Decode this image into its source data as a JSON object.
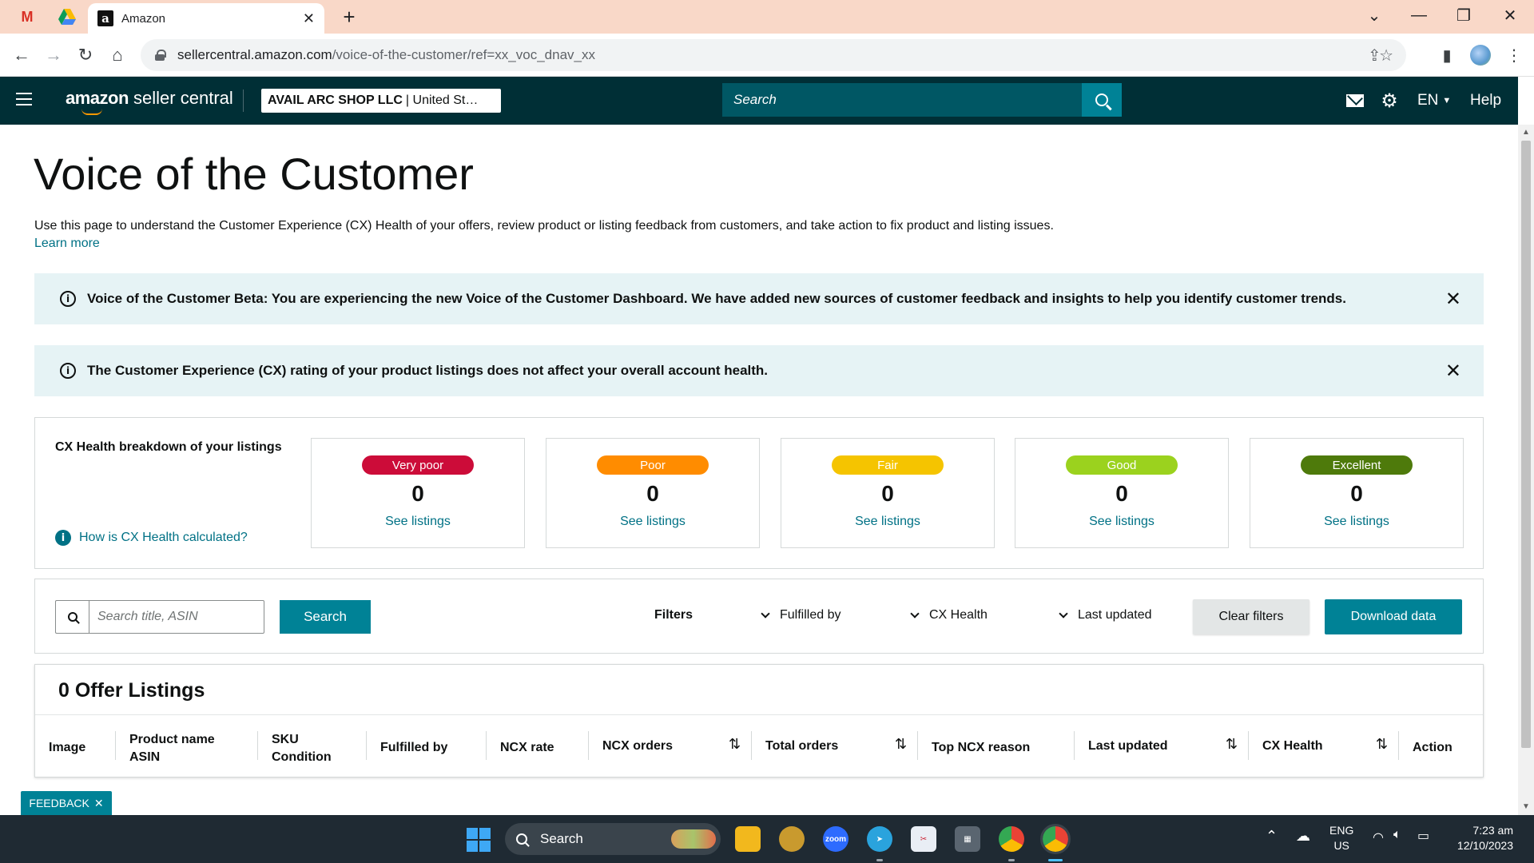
{
  "browser": {
    "active_tab_title": "Amazon",
    "url_host": "sellercentral.amazon.com",
    "url_path": "/voice-of-the-customer/ref=xx_voc_dnav_xx"
  },
  "header": {
    "logo_brand": "amazon",
    "logo_product": "seller central",
    "account_name": "AVAIL ARC SHOP LLC",
    "account_region": "| United St…",
    "search_placeholder": "Search",
    "language": "EN",
    "help": "Help"
  },
  "page": {
    "title": "Voice of the Customer",
    "description": "Use this page to understand the Customer Experience (CX) Health of your offers, review product or listing feedback from customers, and take action to fix product and listing issues.",
    "learn_more": "Learn more",
    "banners": [
      {
        "text": "Voice of the Customer Beta: You are experiencing the new Voice of the Customer Dashboard. We have added new sources of customer feedback and insights to help you identify customer trends."
      },
      {
        "text": "The Customer Experience (CX) rating of your product listings does not affect your overall account health."
      }
    ]
  },
  "cx_health": {
    "heading": "CX Health breakdown of your listings",
    "help_link": "How is CX Health calculated?",
    "cards": [
      {
        "label": "Very poor",
        "count": "0",
        "link": "See listings",
        "bg": "#cc0c39",
        "fg": "#ffffff"
      },
      {
        "label": "Poor",
        "count": "0",
        "link": "See listings",
        "bg": "#ff8c00",
        "fg": "#ffffff"
      },
      {
        "label": "Fair",
        "count": "0",
        "link": "See listings",
        "bg": "#f5c400",
        "fg": "#ffffff"
      },
      {
        "label": "Good",
        "count": "0",
        "link": "See listings",
        "bg": "#9bd21e",
        "fg": "#ffffff"
      },
      {
        "label": "Excellent",
        "count": "0",
        "link": "See listings",
        "bg": "#4e7a0b",
        "fg": "#ffffff"
      }
    ]
  },
  "filters": {
    "search_placeholder": "Search title, ASIN",
    "search_button": "Search",
    "label": "Filters",
    "fulfilled_by": "Fulfilled by",
    "cx_health": "CX Health",
    "last_updated": "Last updated",
    "clear": "Clear filters",
    "download": "Download data"
  },
  "table": {
    "title": "0 Offer Listings",
    "columns": {
      "image": "Image",
      "product_name": "Product name",
      "asin": "ASIN",
      "sku": "SKU",
      "condition": "Condition",
      "fulfilled_by": "Fulfilled by",
      "ncx_rate": "NCX rate",
      "ncx_orders": "NCX orders",
      "total_orders": "Total orders",
      "top_ncx_reason": "Top NCX reason",
      "last_updated": "Last updated",
      "cx_health": "CX Health",
      "action": "Action"
    }
  },
  "feedback_label": "FEEDBACK",
  "taskbar": {
    "search": "Search",
    "lang_top": "ENG",
    "lang_bottom": "US",
    "time": "7:23 am",
    "date": "12/10/2023"
  },
  "colors": {
    "header_bg": "#002f36",
    "accent": "#008296",
    "link": "#007185",
    "banner_bg": "#e6f3f5"
  }
}
